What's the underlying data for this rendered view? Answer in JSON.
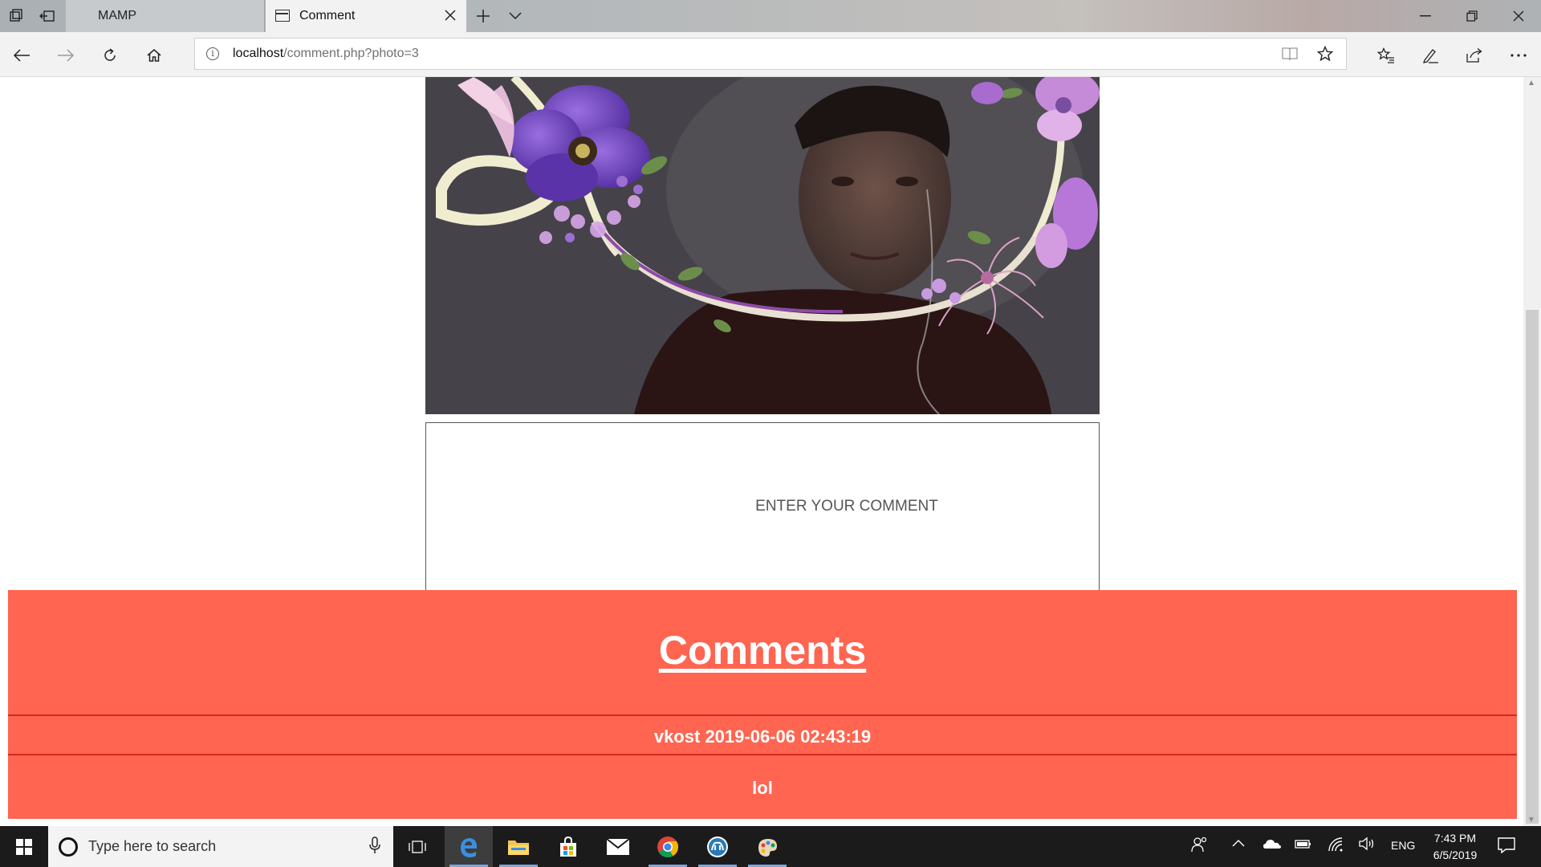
{
  "browser": {
    "tabs": [
      {
        "label": "MAMP",
        "active": false
      },
      {
        "label": "Comment",
        "active": true
      }
    ],
    "address": {
      "host": "localhost",
      "path": "/comment.php?photo=3"
    }
  },
  "page": {
    "comment_input": {
      "placeholder": "ENTER YOUR COMMENT",
      "value": ""
    },
    "comments_section": {
      "title": "Comments",
      "items": [
        {
          "author": "vkost",
          "timestamp": "2019-06-06 02:43:19",
          "text": "lol"
        }
      ]
    },
    "colors": {
      "comments_bg": "#ff6550",
      "comment_rule": "#d6281c"
    }
  },
  "taskbar": {
    "search_placeholder": "Type here to search",
    "apps": [
      "task-view",
      "edge",
      "file-explorer",
      "store",
      "mail",
      "chrome",
      "mamp",
      "paint"
    ],
    "tray": {
      "language": "ENG",
      "time": "7:43 PM",
      "date": "6/5/2019"
    }
  }
}
